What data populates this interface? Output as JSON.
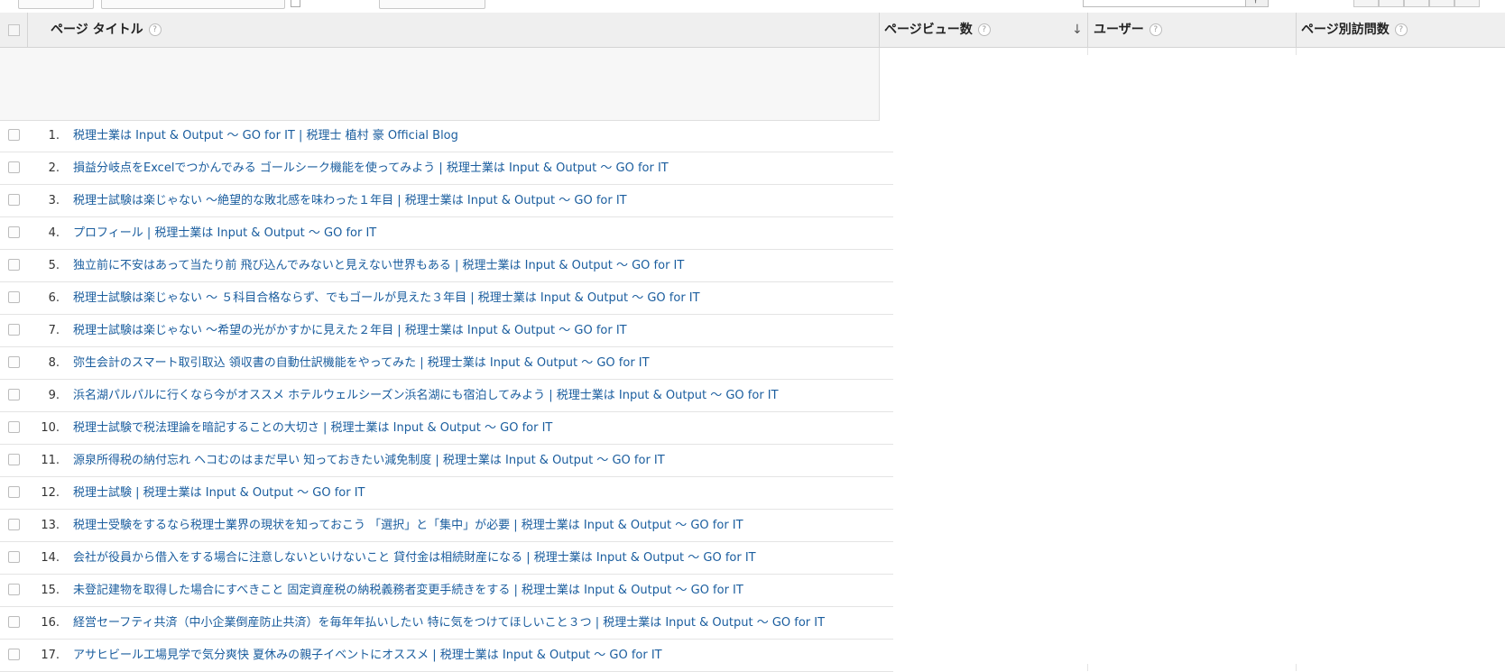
{
  "table": {
    "columns": {
      "title": "ページ タイトル",
      "pageviews": "ページビュー数",
      "users": "ユーザー",
      "unique_pageviews": "ページ別訪問数"
    },
    "help_glyph": "?",
    "sort_glyph": "↓",
    "rows": [
      {
        "index": "1.",
        "title": "税理士業は Input & Output ～ GO for IT | 税理士 植村 豪 Official Blog"
      },
      {
        "index": "2.",
        "title": "損益分岐点をExcelでつかんでみる ゴールシーク機能を使ってみよう | 税理士業は Input & Output ～ GO for IT"
      },
      {
        "index": "3.",
        "title": "税理士試験は楽じゃない ～絶望的な敗北感を味わった１年目 | 税理士業は Input & Output ～ GO for IT"
      },
      {
        "index": "4.",
        "title": "プロフィール | 税理士業は Input & Output ～ GO for IT"
      },
      {
        "index": "5.",
        "title": "独立前に不安はあって当たり前 飛び込んでみないと見えない世界もある | 税理士業は Input & Output ～ GO for IT"
      },
      {
        "index": "6.",
        "title": "税理士試験は楽じゃない ～ ５科目合格ならず、でもゴールが見えた３年目 | 税理士業は Input & Output ～ GO for IT"
      },
      {
        "index": "7.",
        "title": "税理士試験は楽じゃない ～希望の光がかすかに見えた２年目 | 税理士業は Input & Output ～ GO for IT"
      },
      {
        "index": "8.",
        "title": "弥生会計のスマート取引取込 領収書の自動仕訳機能をやってみた | 税理士業は Input & Output ～ GO for IT"
      },
      {
        "index": "9.",
        "title": "浜名湖パルパルに行くなら今がオススメ ホテルウェルシーズン浜名湖にも宿泊してみよう | 税理士業は Input & Output ～ GO for IT"
      },
      {
        "index": "10.",
        "title": "税理士試験で税法理論を暗記することの大切さ | 税理士業は Input & Output ～ GO for IT"
      },
      {
        "index": "11.",
        "title": "源泉所得税の納付忘れ ヘコむのはまだ早い 知っておきたい減免制度 | 税理士業は Input & Output ～ GO for IT"
      },
      {
        "index": "12.",
        "title": "税理士試験 | 税理士業は Input & Output ～ GO for IT"
      },
      {
        "index": "13.",
        "title": "税理士受験をするなら税理士業界の現状を知っておこう 「選択」と「集中」が必要 | 税理士業は Input & Output ～ GO for IT"
      },
      {
        "index": "14.",
        "title": "会社が役員から借入をする場合に注意しないといけないこと 貸付金は相続財産になる | 税理士業は Input & Output ～ GO for IT"
      },
      {
        "index": "15.",
        "title": "未登記建物を取得した場合にすべきこと 固定資産税の納税義務者変更手続きをする | 税理士業は Input & Output ～ GO for IT"
      },
      {
        "index": "16.",
        "title": "経営セーフティ共済（中小企業倒産防止共済）を毎年年払いしたい 特に気をつけてほしいこと３つ | 税理士業は Input & Output ～ GO for IT"
      },
      {
        "index": "17.",
        "title": "アサヒビール工場見学で気分爽快 夏休みの親子イベントにオススメ | 税理士業は Input & Output ～ GO for IT"
      }
    ]
  },
  "colors": {
    "link": "#1a5d9e",
    "header_bg": "#efefef"
  }
}
